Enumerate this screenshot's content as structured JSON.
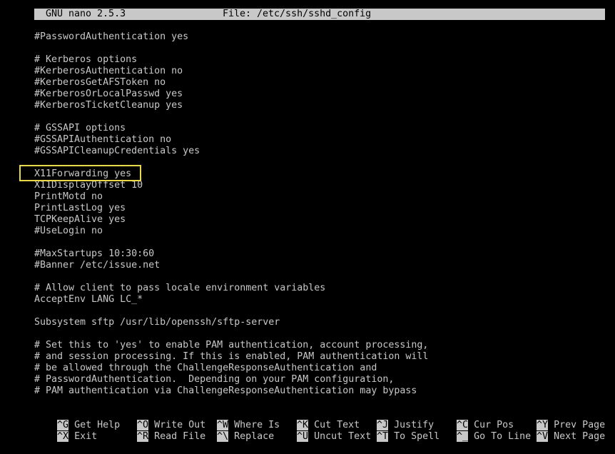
{
  "title_bar": {
    "app": "GNU nano 2.5.3",
    "file": "File: /etc/ssh/sshd_config"
  },
  "editor": {
    "lines": [
      "#PasswordAuthentication yes",
      "",
      "# Kerberos options",
      "#KerberosAuthentication no",
      "#KerberosGetAFSToken no",
      "#KerberosOrLocalPasswd yes",
      "#KerberosTicketCleanup yes",
      "",
      "# GSSAPI options",
      "#GSSAPIAuthentication no",
      "#GSSAPICleanupCredentials yes",
      "",
      "X11Forwarding yes",
      "X11DisplayOffset 10",
      "PrintMotd no",
      "PrintLastLog yes",
      "TCPKeepAlive yes",
      "#UseLogin no",
      "",
      "#MaxStartups 10:30:60",
      "#Banner /etc/issue.net",
      "",
      "# Allow client to pass locale environment variables",
      "AcceptEnv LANG LC_*",
      "",
      "Subsystem sftp /usr/lib/openssh/sftp-server",
      "",
      "# Set this to 'yes' to enable PAM authentication, account processing,",
      "# and session processing. If this is enabled, PAM authentication will",
      "# be allowed through the ChallengeResponseAuthentication and",
      "# PasswordAuthentication.  Depending on your PAM configuration,",
      "# PAM authentication via ChallengeResponseAuthentication may bypass"
    ]
  },
  "shortcuts": {
    "row1": [
      {
        "key": "^G",
        "label": "Get Help"
      },
      {
        "key": "^O",
        "label": "Write Out"
      },
      {
        "key": "^W",
        "label": "Where Is"
      },
      {
        "key": "^K",
        "label": "Cut Text"
      },
      {
        "key": "^J",
        "label": "Justify"
      },
      {
        "key": "^C",
        "label": "Cur Pos"
      },
      {
        "key": "^Y",
        "label": "Prev Page"
      }
    ],
    "row2": [
      {
        "key": "^X",
        "label": "Exit"
      },
      {
        "key": "^R",
        "label": "Read File"
      },
      {
        "key": "^\\",
        "label": "Replace"
      },
      {
        "key": "^U",
        "label": "Uncut Text"
      },
      {
        "key": "^T",
        "label": "To Spell"
      },
      {
        "key": "^_",
        "label": "Go To Line"
      },
      {
        "key": "^V",
        "label": "Next Page"
      }
    ]
  },
  "colors": {
    "background": "#000000",
    "text": "#c8c8c8",
    "highlight_box": "#e8d84a"
  }
}
